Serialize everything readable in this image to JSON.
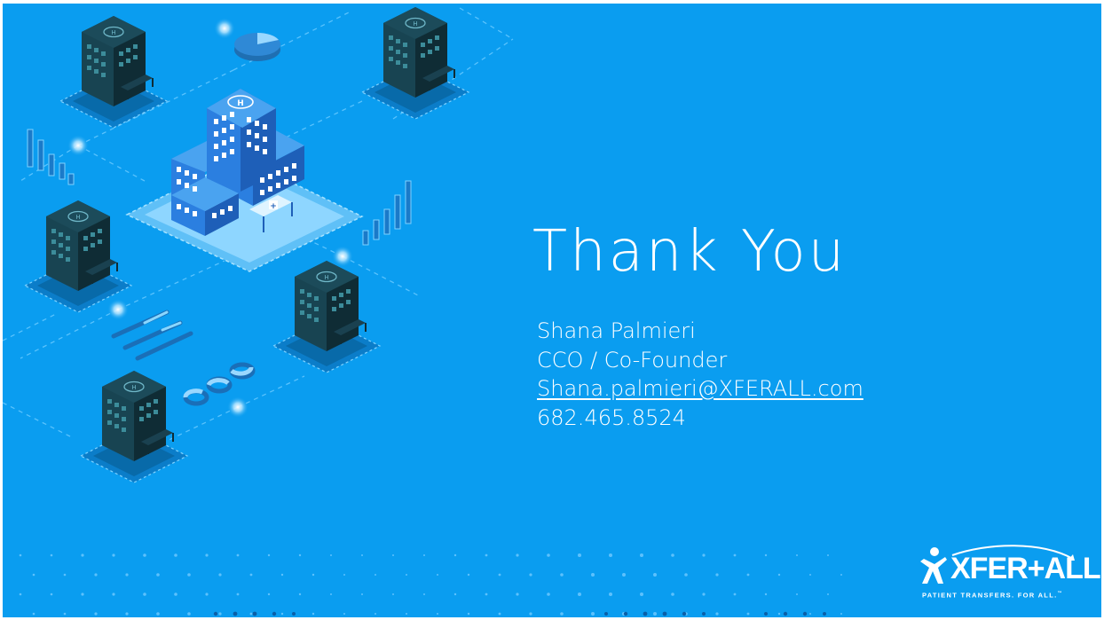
{
  "slide": {
    "title": "Thank You",
    "contact": {
      "name": "Shana Palmieri",
      "role": "CCO / Co-Founder",
      "email": "Shana.palmieri@XFERALL.com",
      "phone": "682.465.8524"
    },
    "logo": {
      "wordmark": "XFER+ALL",
      "tagline": "PATIENT TRANSFERS. FOR ALL.",
      "trademark": "™"
    },
    "illustration": {
      "subject": "isometric-hospital-network-icon",
      "buildings_count": 6
    },
    "colors": {
      "background": "#0a9df0",
      "text": "#ffffff",
      "dark_building": "#12343f",
      "main_building": "#2a7fd6"
    }
  }
}
